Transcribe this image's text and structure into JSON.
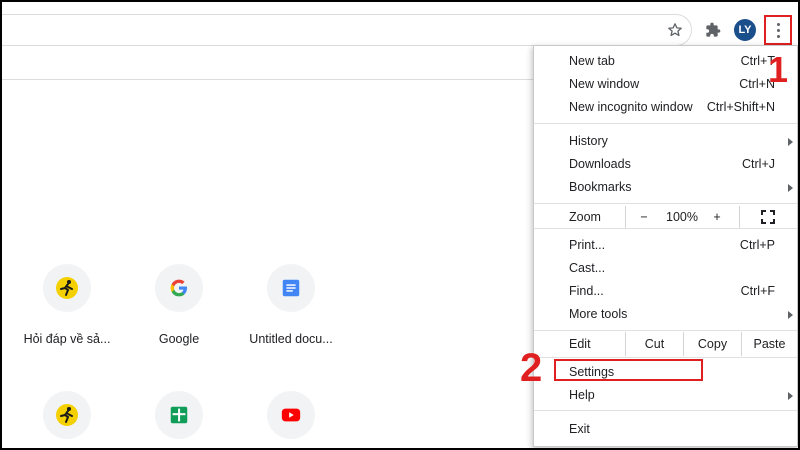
{
  "toolbar": {
    "avatar_initials": "LY",
    "icons": [
      "star-icon",
      "puzzle-icon",
      "kebab-menu-icon"
    ]
  },
  "shortcuts": [
    {
      "label": "Hỏi đáp về sả...",
      "icon": "runner-icon"
    },
    {
      "label": "Google",
      "icon": "google-g-icon"
    },
    {
      "label": "Untitled docu...",
      "icon": "docs-icon"
    },
    {
      "label": "",
      "icon": "runner-icon"
    },
    {
      "label": "",
      "icon": "sheets-icon"
    },
    {
      "label": "",
      "icon": "youtube-icon"
    }
  ],
  "menu": {
    "new_tab": {
      "label": "New tab",
      "shortcut": "Ctrl+T"
    },
    "new_window": {
      "label": "New window",
      "shortcut": "Ctrl+N"
    },
    "new_incognito": {
      "label": "New incognito window",
      "shortcut": "Ctrl+Shift+N"
    },
    "history": {
      "label": "History"
    },
    "downloads": {
      "label": "Downloads",
      "shortcut": "Ctrl+J"
    },
    "bookmarks": {
      "label": "Bookmarks"
    },
    "zoom": {
      "label": "Zoom",
      "minus": "−",
      "value": "100%",
      "plus": "+"
    },
    "print": {
      "label": "Print...",
      "shortcut": "Ctrl+P"
    },
    "cast": {
      "label": "Cast..."
    },
    "find": {
      "label": "Find...",
      "shortcut": "Ctrl+F"
    },
    "more_tools": {
      "label": "More tools"
    },
    "edit": {
      "label": "Edit",
      "cut": "Cut",
      "copy": "Copy",
      "paste": "Paste"
    },
    "settings": {
      "label": "Settings"
    },
    "help": {
      "label": "Help"
    },
    "exit": {
      "label": "Exit"
    }
  },
  "callouts": {
    "one": "1",
    "two": "2"
  },
  "colors": {
    "highlight": "#e02020",
    "avatar": "#1a4f8c"
  }
}
